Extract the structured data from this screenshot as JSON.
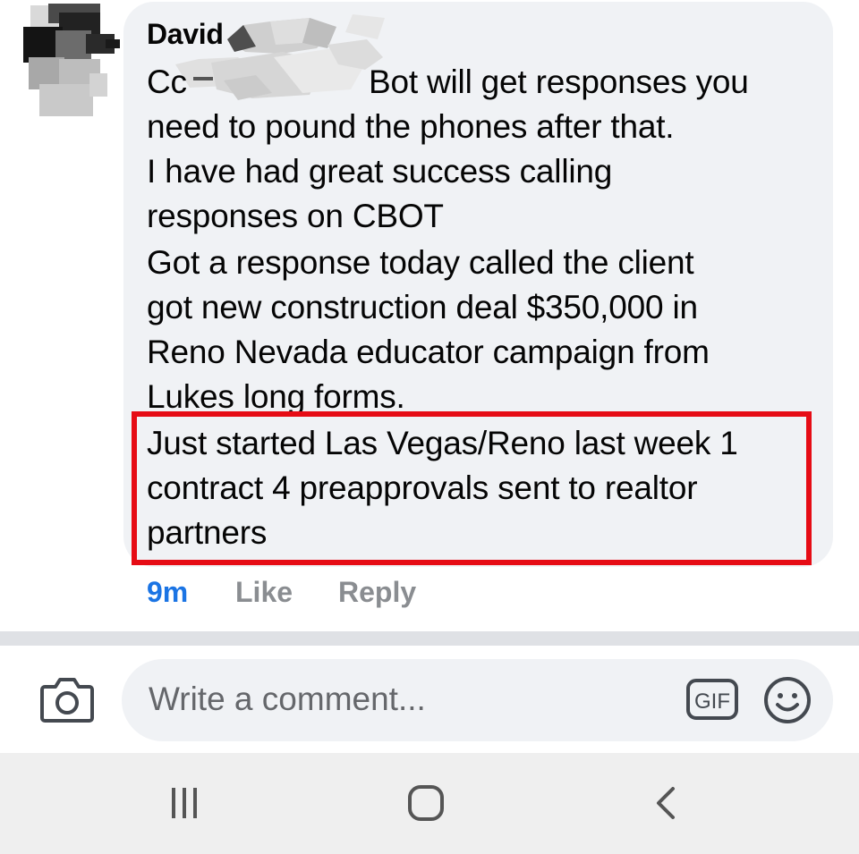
{
  "comment": {
    "author": "David",
    "lines": [
      "Cc",
      "Bot will get responses you",
      "need to pound the phones after that.",
      "I have had great success calling",
      "responses on CBOT",
      "Got a response today called the client",
      "got new construction deal $350,000 in",
      "Reno Nevada educator campaign from",
      "Lukes long forms.",
      "Just started Las Vegas/Reno last week 1",
      "contract 4 preapprovals sent to realtor",
      "partners"
    ],
    "highlight_color": "#e60c15"
  },
  "actions": {
    "time": "9m",
    "like": "Like",
    "reply": "Reply"
  },
  "composer": {
    "placeholder": "Write a comment...",
    "gif_label": "GIF",
    "icons": [
      "camera-icon",
      "gif-icon",
      "smiley-icon"
    ]
  },
  "navbar": {
    "icons": [
      "recent-apps-icon",
      "home-icon",
      "back-icon"
    ]
  },
  "colors": {
    "link_blue": "#1b74e4",
    "muted_gray": "#8a8d91",
    "bubble_bg": "#f0f2f5"
  }
}
